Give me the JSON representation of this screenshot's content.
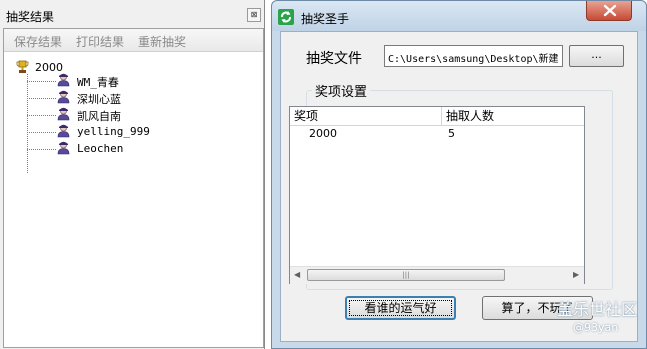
{
  "results_window": {
    "title": "抽奖结果",
    "close_glyph": "⊠",
    "toolbar": {
      "save_label": "保存结果",
      "print_label": "打印结果",
      "redraw_label": "重新抽奖"
    },
    "tree": {
      "root_label": "2000",
      "winners": [
        "WM_青春",
        "深圳心蓝",
        "凯风自南",
        "yelling_999",
        "Leochen"
      ]
    }
  },
  "lottery_window": {
    "title": "抽奖圣手",
    "file_label": "抽奖文件",
    "file_path": "C:\\Users\\samsung\\Desktop\\新建",
    "browse_label": "...",
    "group_label": "奖项设置",
    "columns": [
      "奖项",
      "抽取人数"
    ],
    "rows": [
      {
        "prize": "2000",
        "count": "5"
      }
    ],
    "lucky_button_label": "看谁的运气好",
    "quit_button_label": "算了，不玩了"
  },
  "watermark": {
    "brand": "盖乐世社区",
    "user": "@93yan"
  },
  "colors": {
    "window_frame": "#c8dae9",
    "close_button": "#c74a35",
    "app_icon": "#2aa34a"
  }
}
